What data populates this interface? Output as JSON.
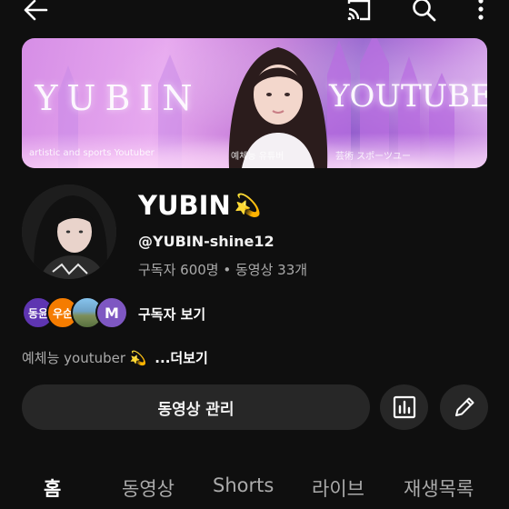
{
  "toolbar": {
    "back_icon": "arrow-left-icon",
    "cast_icon": "cast-icon",
    "search_icon": "search-icon",
    "more_icon": "more-vert-icon"
  },
  "banner": {
    "word_left": "YUBIN",
    "word_right": "YOUTUBE",
    "caption_1": "artistic and sports Youtuber",
    "caption_2": "예체능 유튜버",
    "caption_3": "芸術 スポーツユー"
  },
  "channel": {
    "name": "YUBIN",
    "name_emoji": "💫",
    "handle": "@YUBIN-shine12",
    "stats": "구독자 600명 • 동영상 33개"
  },
  "subscribers": {
    "avatars": [
      "동윤",
      "우순",
      "",
      "M"
    ],
    "link_label": "구독자 보기"
  },
  "description": {
    "text": "예체능 youtuber",
    "emoji": "💫",
    "more_label": "...더보기"
  },
  "actions": {
    "manage_label": "동영상 관리",
    "analytics_icon": "analytics-icon",
    "edit_icon": "pencil-icon"
  },
  "tabs": [
    "홈",
    "동영상",
    "Shorts",
    "라이브",
    "재생목록"
  ],
  "active_tab": "홈",
  "colors": {
    "background": "#0f0f0f",
    "button": "#272727",
    "secondary_text": "#aaaaaa",
    "spark": "#f5c542"
  }
}
